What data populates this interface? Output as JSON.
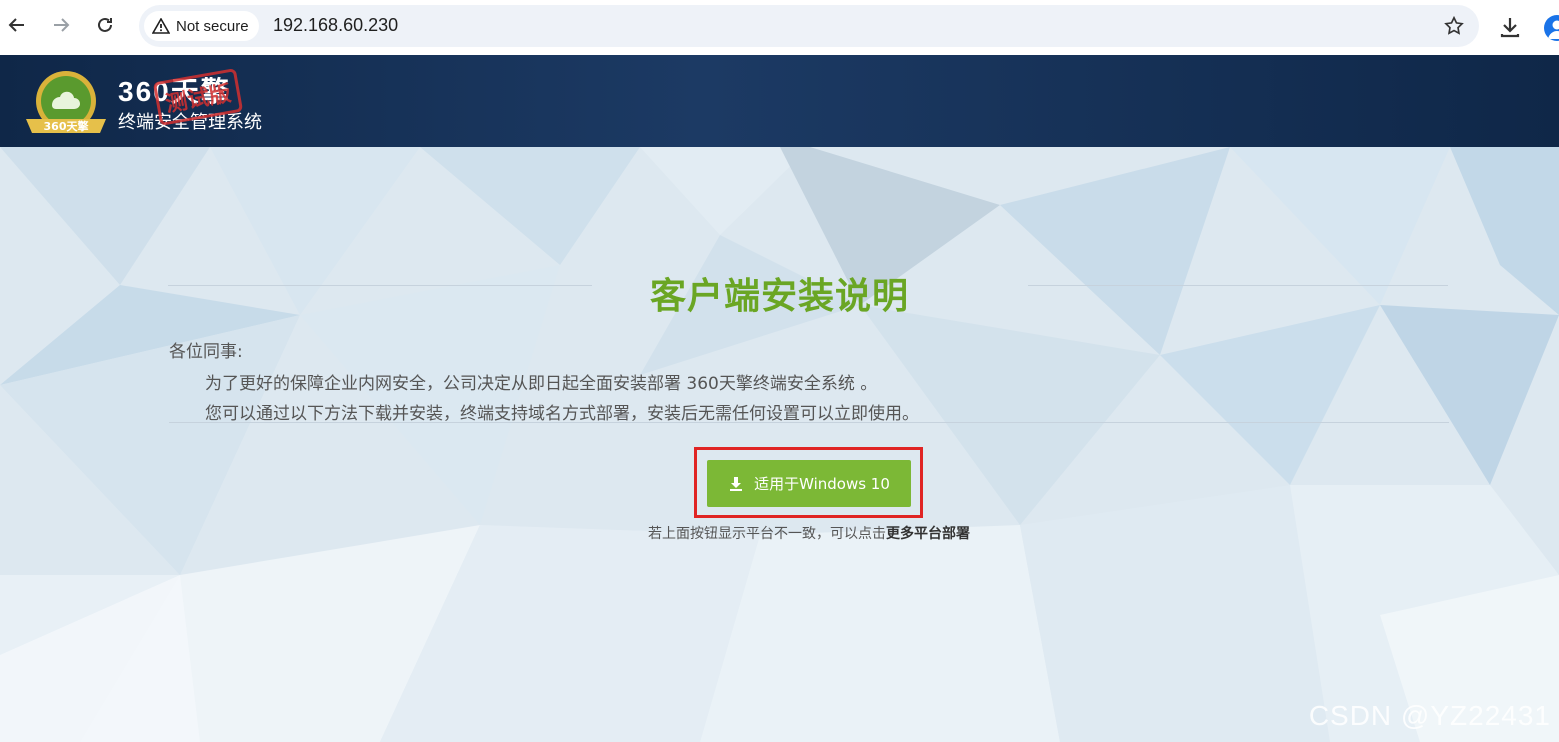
{
  "browser": {
    "security_chip": "Not secure",
    "url": "192.168.60.230"
  },
  "header": {
    "logo_badge_text": "360天擎",
    "logo_title": "360天擎",
    "logo_subtitle": "终端安全管理系统",
    "stamp_text": "测试版"
  },
  "main": {
    "title": "客户端安装说明",
    "greeting": "各位同事:",
    "paragraph1": "为了更好的保障企业内网安全，公司决定从即日起全面安装部署 360天擎终端安全系统 。",
    "paragraph2": "您可以通过以下方法下载并安装，终端支持域名方式部署，安装后无需任何设置可以立即使用。",
    "download_button": "适用于Windows 10",
    "hint_prefix": "若上面按钮显示平台不一致，可以点击",
    "hint_link": "更多平台部署"
  },
  "watermark": "CSDN @YZ22431",
  "colors": {
    "accent_green": "#6aa624",
    "button_green": "#7cb836",
    "highlight_red": "#e02424",
    "header_navy": "#0f2748"
  }
}
